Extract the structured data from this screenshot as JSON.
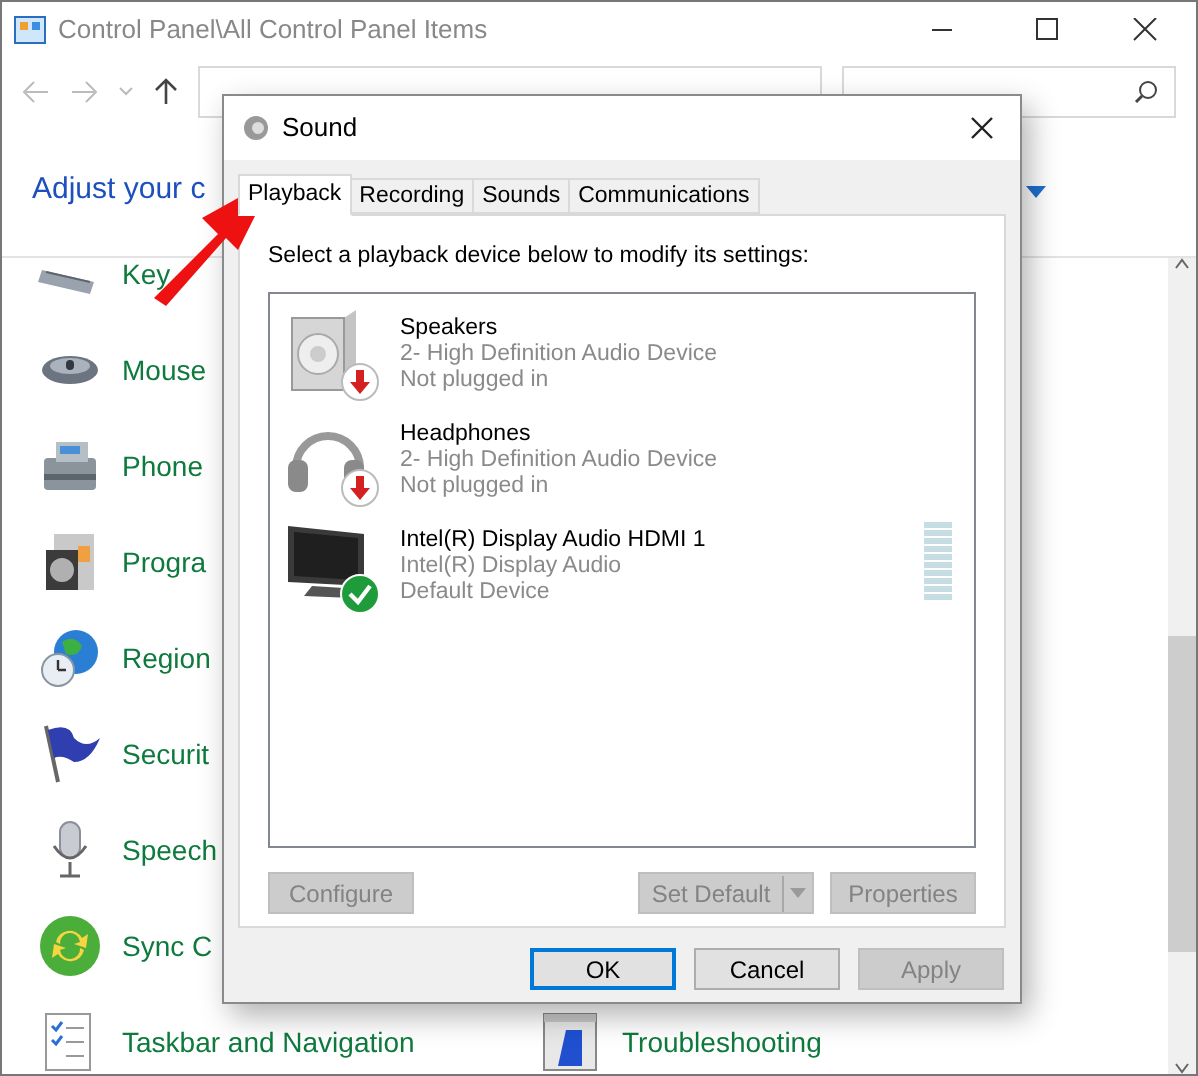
{
  "window": {
    "title": "Control Panel\\All Control Panel Items"
  },
  "heading": "Adjust your c",
  "items": [
    {
      "kind": "keyboard",
      "label": "Key"
    },
    {
      "kind": "mouse",
      "label": "Mouse"
    },
    {
      "kind": "phone",
      "label": "Phone"
    },
    {
      "kind": "programs",
      "label": "Progra"
    },
    {
      "kind": "region",
      "label": "Region"
    },
    {
      "kind": "security",
      "label": "Securit"
    },
    {
      "kind": "speech",
      "label": "Speech"
    },
    {
      "kind": "sync",
      "label": "Sync C"
    },
    {
      "kind": "taskbar",
      "label": "Taskbar and Navigation"
    }
  ],
  "column_2_items": [
    {
      "kind": "troubleshooting",
      "label": "Troubleshooting"
    }
  ],
  "dialog": {
    "title": "Sound",
    "tabs": [
      {
        "label": "Playback",
        "selected": true
      },
      {
        "label": "Recording",
        "selected": false
      },
      {
        "label": "Sounds",
        "selected": false
      },
      {
        "label": "Communications",
        "selected": false
      }
    ],
    "instruction": "Select a playback device below to modify its settings:",
    "devices": [
      {
        "kind": "speakers",
        "default": false,
        "name": "Speakers",
        "driver": "2- High Definition Audio Device",
        "state": "Not plugged in"
      },
      {
        "kind": "headphones",
        "default": false,
        "name": "Headphones",
        "driver": "2- High Definition Audio Device",
        "state": "Not plugged in"
      },
      {
        "kind": "monitor",
        "default": true,
        "name": "Intel(R) Display Audio HDMI 1",
        "driver": "Intel(R) Display Audio",
        "state": "Default Device",
        "meter": {
          "level": 0
        }
      }
    ],
    "configure": {
      "label": "Configure",
      "disabled": true
    },
    "set_default": {
      "label": "Set Default",
      "disabled": true
    },
    "properties": {
      "label": "Properties",
      "disabled": true
    },
    "buttons": [
      {
        "label": "OK",
        "disabled": false,
        "default": true
      },
      {
        "label": "Cancel",
        "disabled": false,
        "default": false
      },
      {
        "label": "Apply",
        "disabled": true,
        "default": false
      }
    ]
  }
}
